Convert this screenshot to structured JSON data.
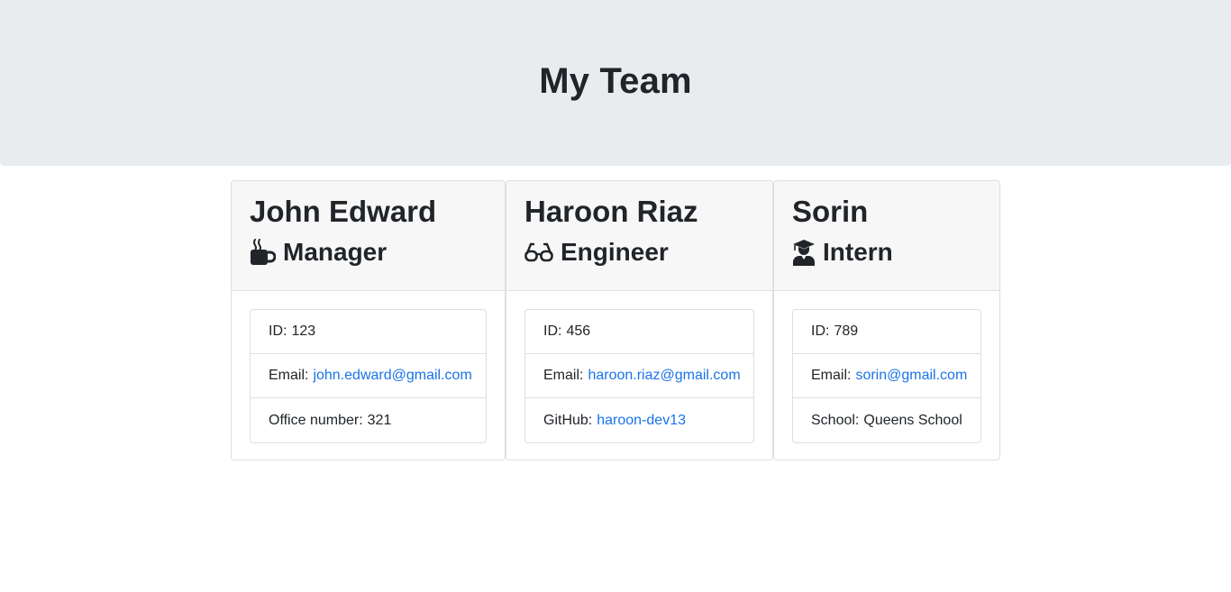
{
  "header": {
    "title": "My Team"
  },
  "team": [
    {
      "name": "John Edward",
      "role": "Manager",
      "icon": "coffee-mug-icon",
      "id_label": "ID:",
      "id_value": "123",
      "email_label": "Email:",
      "email": "john.edward@gmail.com",
      "extra_label": "Office number:",
      "extra_value": "321"
    },
    {
      "name": "Haroon Riaz",
      "role": "Engineer",
      "icon": "glasses-icon",
      "id_label": "ID:",
      "id_value": "456",
      "email_label": "Email:",
      "email": "haroon.riaz@gmail.com",
      "extra_label": "GitHub:",
      "extra_value": "haroon-dev13"
    },
    {
      "name": "Sorin",
      "role": "Intern",
      "icon": "graduate-icon",
      "id_label": "ID:",
      "id_value": "789",
      "email_label": "Email:",
      "email": "sorin@gmail.com",
      "extra_label": "School:",
      "extra_value": "Queens School"
    }
  ],
  "colors": {
    "header_bg": "#e9ecef",
    "card_header_bg": "#f7f7f7",
    "link": "#1a73e8",
    "text": "#212529"
  }
}
